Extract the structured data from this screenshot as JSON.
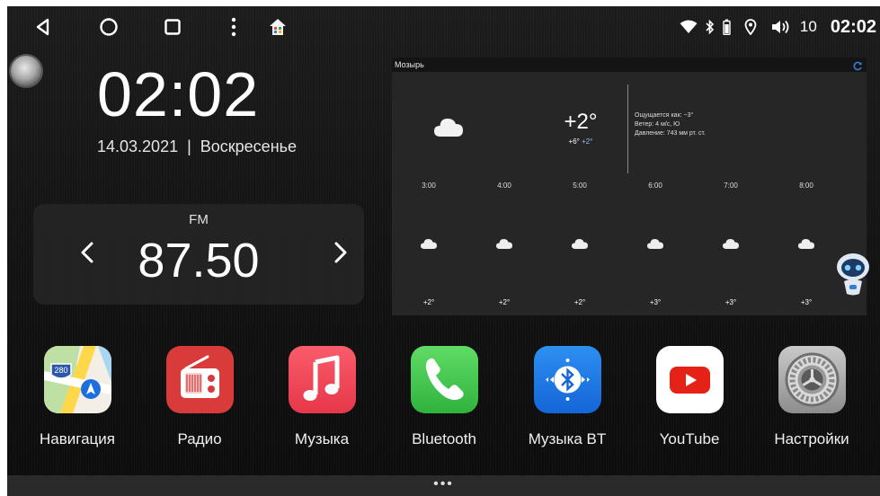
{
  "status_bar": {
    "nav_icons": [
      "back-icon",
      "home-icon",
      "recents-icon",
      "menu-dots-icon",
      "house-icon"
    ],
    "status_icons": [
      "wifi-icon",
      "bluetooth-icon",
      "battery-icon",
      "location-icon",
      "volume-icon"
    ],
    "volume": "10",
    "time": "02:02"
  },
  "clock": {
    "time": "02:02",
    "date": "14.03.2021  |  Воскресенье"
  },
  "radio": {
    "band": "FM",
    "frequency": "87.50"
  },
  "weather": {
    "city": "Мозырь",
    "current_temp": "+2°",
    "high": "+6°",
    "low": "+2°",
    "feels_like": "Ощущается как: −3°",
    "wind": "Ветер: 4 м/с, Ю",
    "pressure": "Давление: 743 мм рт. ст.",
    "hourly": [
      {
        "time": "3:00",
        "temp": "+2°"
      },
      {
        "time": "4:00",
        "temp": "+2°"
      },
      {
        "time": "5:00",
        "temp": "+2°"
      },
      {
        "time": "6:00",
        "temp": "+3°"
      },
      {
        "time": "7:00",
        "temp": "+3°"
      },
      {
        "time": "8:00",
        "temp": "+3°"
      }
    ]
  },
  "apps": [
    {
      "label": "Навигация",
      "icon": "maps-icon"
    },
    {
      "label": "Радио",
      "icon": "radio-icon"
    },
    {
      "label": "Музыка",
      "icon": "music-icon"
    },
    {
      "label": "Bluetooth",
      "icon": "phone-icon"
    },
    {
      "label": "Музыка BT",
      "icon": "bluetooth-music-icon"
    },
    {
      "label": "YouTube",
      "icon": "youtube-icon"
    },
    {
      "label": "Настройки",
      "icon": "settings-icon"
    }
  ],
  "bottom_bar": {
    "dots": "•••"
  },
  "colors": {
    "radio_app": "#d93a3a",
    "music_app": "#f0505a",
    "phone_app": "#3dc44a",
    "bt_music_app": "#1e7ee6",
    "youtube_red": "#e62117",
    "accent_blue": "#3a7bd5"
  }
}
